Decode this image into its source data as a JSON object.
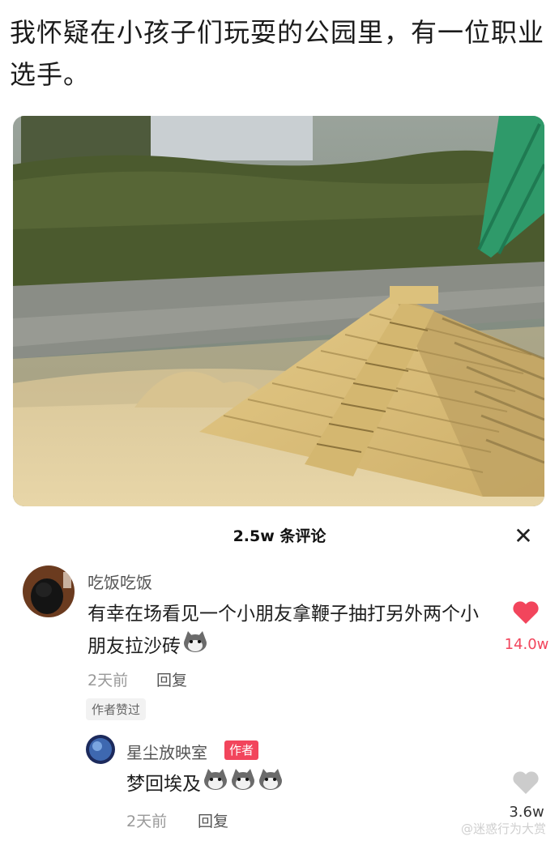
{
  "post": {
    "text": "我怀疑在小孩子们玩耍的公园里，有一位职业选手。"
  },
  "comments_panel": {
    "title": "2.5w 条评论",
    "close_symbol": "✕"
  },
  "comments": [
    {
      "username": "吃饭吃饭",
      "text": "有幸在场看见一个小朋友拿鞭子抽打另外两个小朋友拉沙砖",
      "time": "2天前",
      "reply_label": "回复",
      "liked_by_author_label": "作者赞过",
      "like_count": "14.0w",
      "liked": true,
      "like_color": "#f2455c"
    }
  ],
  "reply": {
    "username": "星尘放映室",
    "author_badge": "作者",
    "text": "梦回埃及",
    "time": "2天前",
    "reply_label": "回复",
    "like_count": "3.6w",
    "liked": false,
    "like_color": "#cccccc"
  },
  "watermark": "@迷惑行为大赏"
}
